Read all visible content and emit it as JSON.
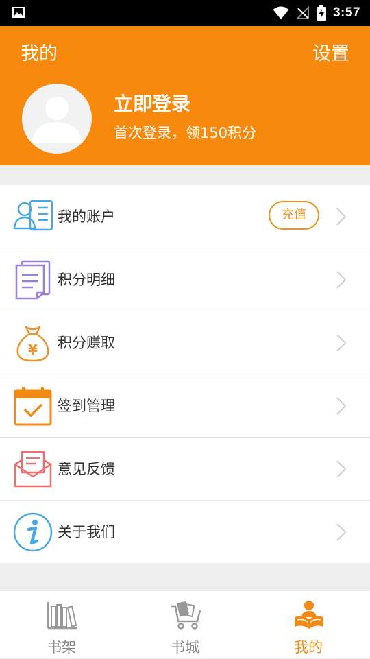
{
  "status_bar": {
    "time": "3:57"
  },
  "header": {
    "title": "我的",
    "settings_label": "设置",
    "login_title": "立即登录",
    "login_subtitle": "首次登录，领150积分"
  },
  "menu": {
    "items": [
      {
        "label": "我的账户",
        "icon": "account-icon",
        "badge": "充值"
      },
      {
        "label": "积分明细",
        "icon": "points-detail-icon"
      },
      {
        "label": "积分赚取",
        "icon": "money-bag-icon"
      },
      {
        "label": "签到管理",
        "icon": "calendar-check-icon"
      },
      {
        "label": "意见反馈",
        "icon": "envelope-icon"
      },
      {
        "label": "关于我们",
        "icon": "info-icon"
      }
    ]
  },
  "bottom_nav": {
    "items": [
      {
        "label": "书架",
        "icon": "bookshelf-icon",
        "active": false
      },
      {
        "label": "书城",
        "icon": "book-cart-icon",
        "active": false
      },
      {
        "label": "我的",
        "icon": "reader-icon",
        "active": true
      }
    ]
  },
  "colors": {
    "accent": "#f7890c",
    "active_tab": "#f08a17"
  }
}
